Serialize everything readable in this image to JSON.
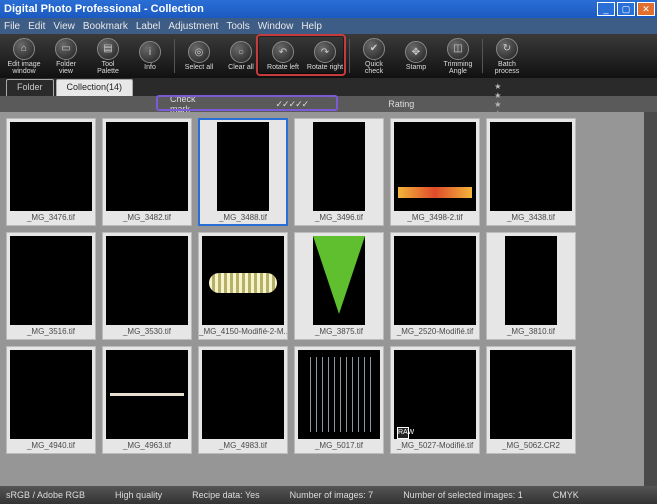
{
  "window": {
    "title": "Digital Photo Professional - Collection"
  },
  "menu": [
    "File",
    "Edit",
    "View",
    "Bookmark",
    "Label",
    "Adjustment",
    "Tools",
    "Window",
    "Help"
  ],
  "toolbar": [
    {
      "id": "edit-image-window",
      "label": "Edit image\nwindow",
      "glyph": "⌂"
    },
    {
      "id": "folder-view",
      "label": "Folder\nview",
      "glyph": "▭"
    },
    {
      "id": "tool-palette",
      "label": "Tool\nPalette",
      "glyph": "▤"
    },
    {
      "id": "info",
      "label": "Info",
      "glyph": "i"
    },
    {
      "sep": true
    },
    {
      "id": "select-all",
      "label": "Select all",
      "glyph": "◎"
    },
    {
      "id": "clear-all",
      "label": "Clear all",
      "glyph": "○"
    },
    {
      "id": "rotate-left",
      "label": "Rotate left",
      "glyph": "↶"
    },
    {
      "id": "rotate-right",
      "label": "Rotate right",
      "glyph": "↷"
    },
    {
      "sep": true
    },
    {
      "id": "quick-check",
      "label": "Quick\ncheck",
      "glyph": "✔"
    },
    {
      "id": "stamp",
      "label": "Stamp",
      "glyph": "✥"
    },
    {
      "id": "trimming-angle",
      "label": "Trimming\nAngle",
      "glyph": "◫"
    },
    {
      "sep": true
    },
    {
      "id": "batch-process",
      "label": "Batch\nprocess",
      "glyph": "↻"
    }
  ],
  "tabs": {
    "folder": "Folder",
    "collection": "Collection(14)"
  },
  "filter": {
    "checkmark_label": "Check mark",
    "ticks": "✓✓✓✓✓",
    "rating_label": "Rating",
    "stars": "★ ★ ★ ★ ★"
  },
  "thumbs": [
    {
      "name": "_MG_3476.tif",
      "cls": "p-castle"
    },
    {
      "name": "_MG_3482.tif",
      "cls": "p-castle2"
    },
    {
      "name": "_MG_3488.tif",
      "cls": "p-castle3",
      "selected": true,
      "tall": true
    },
    {
      "name": "_MG_3496.tif",
      "cls": "p-trees",
      "tall": true
    },
    {
      "name": "_MG_3498-2.tif",
      "cls": "p-lit"
    },
    {
      "name": "_MG_3438.tif",
      "cls": "p-moss"
    },
    {
      "name": "_MG_3516.tif",
      "cls": "p-dark"
    },
    {
      "name": "_MG_3530.tif",
      "cls": "p-night"
    },
    {
      "name": "_MG_4150-Modifié-2-M...",
      "cls": "p-worm"
    },
    {
      "name": "_MG_3875.tif",
      "cls": "p-leaf",
      "tall": true
    },
    {
      "name": "_MG_2520-Modifié.tif",
      "cls": "p-flower"
    },
    {
      "name": "_MG_3810.tif",
      "cls": "p-seed",
      "tall": true
    },
    {
      "name": "_MG_4940.tif",
      "cls": "p-frost1"
    },
    {
      "name": "_MG_4963.tif",
      "cls": "p-frost2"
    },
    {
      "name": "_MG_4983.tif",
      "cls": "p-frost3"
    },
    {
      "name": "_MG_5017.tif",
      "cls": "p-rain"
    },
    {
      "name": "_MG_5027-Modifié.tif",
      "cls": "p-drops",
      "badge": "RAW"
    },
    {
      "name": "_MG_5062.CR2",
      "cls": "p-yellow"
    }
  ],
  "status": {
    "cspace": "sRGB / Adobe RGB",
    "quality": "High quality",
    "recipe": "Recipe data: Yes",
    "count": "Number of images: 7",
    "selected": "Number of selected images: 1",
    "mode": "CMYK"
  }
}
